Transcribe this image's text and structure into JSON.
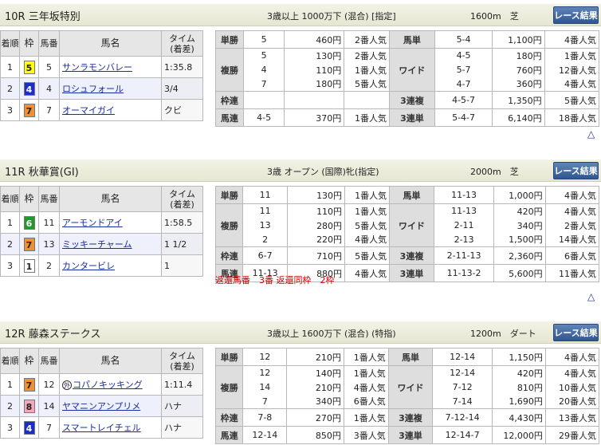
{
  "races": [
    {
      "name": "10R 三年坂特別",
      "conditions": "3歳以上 1000万下 (混合) [指定]",
      "distance": "1600m　芝",
      "button": "レース結果",
      "headers": {
        "rank": "着順",
        "waku": "枠",
        "uma": "馬番",
        "horse": "馬名",
        "time": "タイム (着差)"
      },
      "results": [
        {
          "rank": "1",
          "waku": "5",
          "waku_color": "#ffff00",
          "waku_text": "#222222",
          "uma": "5",
          "horse": "サンラモンバレー",
          "mark": "",
          "time": "1:35.8"
        },
        {
          "rank": "2",
          "waku": "4",
          "waku_color": "#1a2ecc",
          "waku_text": "#ffffff",
          "uma": "4",
          "horse": "ロシュフォール",
          "mark": "",
          "time": "3/4"
        },
        {
          "rank": "3",
          "waku": "7",
          "waku_color": "#f09030",
          "waku_text": "#222222",
          "uma": "7",
          "horse": "オーマイガイ",
          "mark": "",
          "time": "クビ"
        }
      ],
      "payouts": {
        "tansho": {
          "label": "単勝",
          "rows": [
            {
              "combo": "5",
              "pay": "460円",
              "pop": "2番人気"
            }
          ]
        },
        "fukusho": {
          "label": "複勝",
          "rows": [
            {
              "combo": "5",
              "pay": "130円",
              "pop": "2番人気"
            },
            {
              "combo": "4",
              "pay": "110円",
              "pop": "1番人気"
            },
            {
              "combo": "7",
              "pay": "180円",
              "pop": "5番人気"
            }
          ]
        },
        "wakuren": {
          "label": "枠連",
          "rows": [
            {
              "combo": "",
              "pay": "",
              "pop": ""
            }
          ]
        },
        "umaren": {
          "label": "馬連",
          "rows": [
            {
              "combo": "4-5",
              "pay": "370円",
              "pop": "1番人気"
            }
          ]
        },
        "umatan": {
          "label": "馬単",
          "rows": [
            {
              "combo": "5-4",
              "pay": "1,100円",
              "pop": "4番人気"
            }
          ]
        },
        "wide": {
          "label": "ワイド",
          "rows": [
            {
              "combo": "4-5",
              "pay": "180円",
              "pop": "1番人気"
            },
            {
              "combo": "5-7",
              "pay": "760円",
              "pop": "12番人気"
            },
            {
              "combo": "4-7",
              "pay": "360円",
              "pop": "4番人気"
            }
          ]
        },
        "sanrenpuku": {
          "label": "3連複",
          "rows": [
            {
              "combo": "4-5-7",
              "pay": "1,350円",
              "pop": "5番人気"
            }
          ]
        },
        "sanrentan": {
          "label": "3連単",
          "rows": [
            {
              "combo": "5-4-7",
              "pay": "6,140円",
              "pop": "18番人気"
            }
          ]
        }
      },
      "note": "",
      "top_link": "△"
    },
    {
      "name": "11R 秋華賞(GI)",
      "conditions": "3歳 オープン (国際)牝(指定)",
      "distance": "2000m　芝",
      "button": "レース結果",
      "headers": {
        "rank": "着順",
        "waku": "枠",
        "uma": "馬番",
        "horse": "馬名",
        "time": "タイム (着差)"
      },
      "results": [
        {
          "rank": "1",
          "waku": "6",
          "waku_color": "#1e9a28",
          "waku_text": "#ffffff",
          "uma": "11",
          "horse": "アーモンドアイ",
          "mark": "",
          "time": "1:58.5"
        },
        {
          "rank": "2",
          "waku": "7",
          "waku_color": "#f09030",
          "waku_text": "#222222",
          "uma": "13",
          "horse": "ミッキーチャーム",
          "mark": "",
          "time": "1 1/2"
        },
        {
          "rank": "3",
          "waku": "1",
          "waku_color": "#ffffff",
          "waku_text": "#222222",
          "uma": "2",
          "horse": "カンタービレ",
          "mark": "",
          "time": "1"
        }
      ],
      "payouts": {
        "tansho": {
          "label": "単勝",
          "rows": [
            {
              "combo": "11",
              "pay": "130円",
              "pop": "1番人気"
            }
          ]
        },
        "fukusho": {
          "label": "複勝",
          "rows": [
            {
              "combo": "11",
              "pay": "110円",
              "pop": "1番人気"
            },
            {
              "combo": "13",
              "pay": "280円",
              "pop": "5番人気"
            },
            {
              "combo": "2",
              "pay": "220円",
              "pop": "4番人気"
            }
          ]
        },
        "wakuren": {
          "label": "枠連",
          "rows": [
            {
              "combo": "6-7",
              "pay": "710円",
              "pop": "5番人気"
            }
          ]
        },
        "umaren": {
          "label": "馬連",
          "rows": [
            {
              "combo": "11-13",
              "pay": "880円",
              "pop": "4番人気"
            }
          ]
        },
        "umatan": {
          "label": "馬単",
          "rows": [
            {
              "combo": "11-13",
              "pay": "1,000円",
              "pop": "4番人気"
            }
          ]
        },
        "wide": {
          "label": "ワイド",
          "rows": [
            {
              "combo": "11-13",
              "pay": "420円",
              "pop": "4番人気"
            },
            {
              "combo": "2-11",
              "pay": "340円",
              "pop": "2番人気"
            },
            {
              "combo": "2-13",
              "pay": "1,500円",
              "pop": "14番人気"
            }
          ]
        },
        "sanrenpuku": {
          "label": "3連複",
          "rows": [
            {
              "combo": "2-11-13",
              "pay": "2,360円",
              "pop": "6番人気"
            }
          ]
        },
        "sanrentan": {
          "label": "3連単",
          "rows": [
            {
              "combo": "11-13-2",
              "pay": "5,600円",
              "pop": "11番人気"
            }
          ]
        }
      },
      "note": "返還馬番　3番 返還同枠　2枠",
      "top_link": "△"
    },
    {
      "name": "12R 藤森ステークス",
      "conditions": "3歳以上 1600万下 (混合) (特指)",
      "distance": "1200m　ダート",
      "button": "レース結果",
      "headers": {
        "rank": "着順",
        "waku": "枠",
        "uma": "馬番",
        "horse": "馬名",
        "time": "タイム (着差)"
      },
      "results": [
        {
          "rank": "1",
          "waku": "7",
          "waku_color": "#f09030",
          "waku_text": "#222222",
          "uma": "12",
          "horse": "コパノキッキング",
          "mark": "外",
          "time": "1:11.4"
        },
        {
          "rank": "2",
          "waku": "8",
          "waku_color": "#f4a8b8",
          "waku_text": "#222222",
          "uma": "14",
          "horse": "ヤマニンアンプリメ",
          "mark": "",
          "time": "ハナ"
        },
        {
          "rank": "3",
          "waku": "4",
          "waku_color": "#1a2ecc",
          "waku_text": "#ffffff",
          "uma": "7",
          "horse": "スマートレイチェル",
          "mark": "",
          "time": "ハナ"
        }
      ],
      "payouts": {
        "tansho": {
          "label": "単勝",
          "rows": [
            {
              "combo": "12",
              "pay": "210円",
              "pop": "1番人気"
            }
          ]
        },
        "fukusho": {
          "label": "複勝",
          "rows": [
            {
              "combo": "12",
              "pay": "140円",
              "pop": "1番人気"
            },
            {
              "combo": "14",
              "pay": "210円",
              "pop": "4番人気"
            },
            {
              "combo": "7",
              "pay": "340円",
              "pop": "6番人気"
            }
          ]
        },
        "wakuren": {
          "label": "枠連",
          "rows": [
            {
              "combo": "7-8",
              "pay": "270円",
              "pop": "1番人気"
            }
          ]
        },
        "umaren": {
          "label": "馬連",
          "rows": [
            {
              "combo": "12-14",
              "pay": "850円",
              "pop": "3番人気"
            }
          ]
        },
        "umatan": {
          "label": "馬単",
          "rows": [
            {
              "combo": "12-14",
              "pay": "1,150円",
              "pop": "4番人気"
            }
          ]
        },
        "wide": {
          "label": "ワイド",
          "rows": [
            {
              "combo": "12-14",
              "pay": "420円",
              "pop": "4番人気"
            },
            {
              "combo": "7-12",
              "pay": "810円",
              "pop": "10番人気"
            },
            {
              "combo": "7-14",
              "pay": "1,690円",
              "pop": "20番人気"
            }
          ]
        },
        "sanrenpuku": {
          "label": "3連複",
          "rows": [
            {
              "combo": "7-12-14",
              "pay": "4,430円",
              "pop": "13番人気"
            }
          ]
        },
        "sanrentan": {
          "label": "3連単",
          "rows": [
            {
              "combo": "12-14-7",
              "pay": "12,000円",
              "pop": "29番人気"
            }
          ]
        }
      },
      "note": "",
      "top_link": "△"
    }
  ]
}
